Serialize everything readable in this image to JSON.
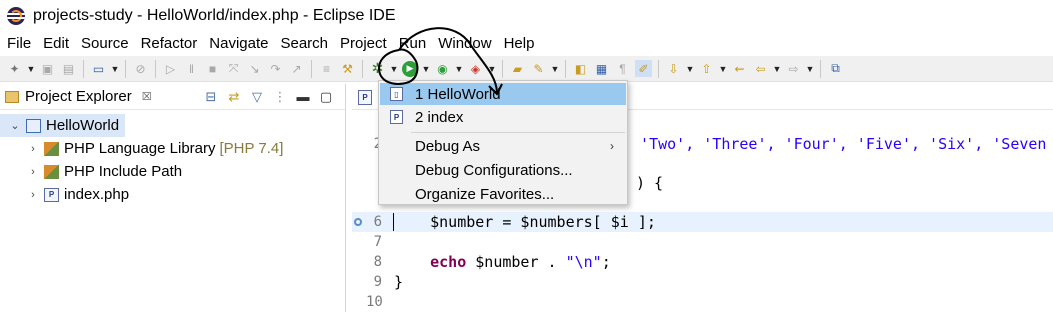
{
  "window": {
    "title": "projects-study - HelloWorld/index.php - Eclipse IDE"
  },
  "menubar": {
    "items": [
      "File",
      "Edit",
      "Source",
      "Refactor",
      "Navigate",
      "Search",
      "Project",
      "Run",
      "Window",
      "Help"
    ]
  },
  "toolbar": {
    "debug_icon": "debug-bug-icon",
    "run_icon": "run-play-icon"
  },
  "explorer": {
    "title": "Project Explorer",
    "close_glyph": "☒",
    "tree": [
      {
        "label": "HelloWorld",
        "tag": "",
        "icon": "project-icon",
        "expanded": true
      },
      {
        "label": "PHP Language Library",
        "tag": "[PHP 7.4]",
        "icon": "library-icon"
      },
      {
        "label": "PHP Include Path",
        "tag": "",
        "icon": "library-icon"
      },
      {
        "label": "index.php",
        "tag": "",
        "icon": "php-file-icon"
      }
    ]
  },
  "editor": {
    "tab_icon": "php-file-icon",
    "lines": [
      {
        "num": "",
        "text": ""
      },
      {
        "num": "2",
        "text": ", 'Two', 'Three', 'Four', 'Five', 'Six', 'Seven"
      },
      {
        "num": "",
        "text": ""
      },
      {
        "num": "",
        "text": ") {"
      },
      {
        "num": "",
        "text": ""
      },
      {
        "num": "6",
        "text": "    $number = $numbers[ $i ];"
      },
      {
        "num": "7",
        "text": ""
      },
      {
        "num": "8",
        "text": "    echo $number . \"\\n\";"
      },
      {
        "num": "9",
        "text": "}"
      },
      {
        "num": "10",
        "text": ""
      }
    ]
  },
  "debug_dropdown": {
    "items": [
      {
        "label": "1 HelloWorld",
        "icon": "php-launch-icon",
        "hover": true
      },
      {
        "label": "2 index",
        "icon": "php-file-icon"
      },
      {
        "label": "Debug As",
        "submenu": true
      },
      {
        "label": "Debug Configurations..."
      },
      {
        "label": "Organize Favorites..."
      }
    ]
  },
  "colors": {
    "selection": "#d9e7f8",
    "menu_hover": "#99c9ef",
    "current_line": "#e8f2fe",
    "string": "#2a00ff",
    "keyword": "#7f0055"
  }
}
